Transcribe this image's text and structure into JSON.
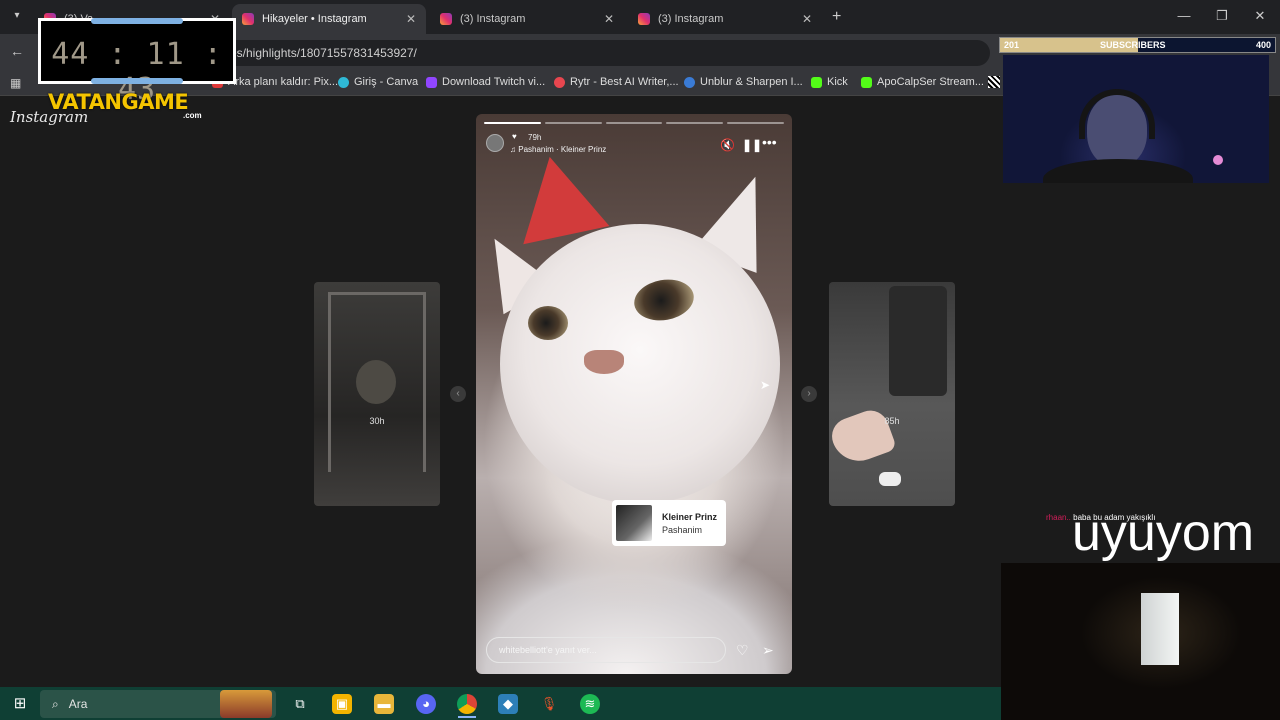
{
  "browser": {
    "tabs": [
      {
        "label": "(3) Va...",
        "active": false
      },
      {
        "label": "Hikayeler • Instagram",
        "active": true
      },
      {
        "label": "(3) Instagram",
        "active": false
      },
      {
        "label": "(3) Instagram",
        "active": false
      }
    ],
    "new_tab": "+",
    "url": "es/highlights/18071557831453927/",
    "bookmarks": [
      "Arka planı kaldır: Pix...",
      "Giriş - Canva",
      "Download Twitch vi...",
      "Rytr - Best AI Writer,...",
      "Unblur & Sharpen I...",
      "Kick",
      "ApoCalpSer Stream..."
    ]
  },
  "instagram": {
    "logo": "Instagram",
    "story": {
      "time": "79h",
      "song_line": "Pashanim · Kleiner Prinz",
      "sticker_title": "Kleiner Prinz",
      "sticker_artist": "Pashanim",
      "reply_placeholder": "whitebelliott'e yanıt ver...",
      "progress_total": 5,
      "progress_done": 1
    },
    "prev_story_age": "30h",
    "next_story_age": "85h"
  },
  "overlay": {
    "timer": "44 : 11 : 43",
    "brand": "VATANGAME",
    "brand_sub": ".com",
    "subs_current": "201",
    "subs_label": "SUBSCRIBERS",
    "subs_goal": "400",
    "subs_fraction": 0.5,
    "chat_user": "rhaan..",
    "chat_text": "baba bu adam yakışıklı",
    "big_text": "uyuyom"
  },
  "taskbar": {
    "search_placeholder": "Ara"
  },
  "colors": {
    "browser_dark": "#202124",
    "browser_toolbar": "#35363a",
    "taskbar": "#0f3f34",
    "subs_fill": "#d7c28c",
    "timer_bar": "#7eb1e3"
  }
}
